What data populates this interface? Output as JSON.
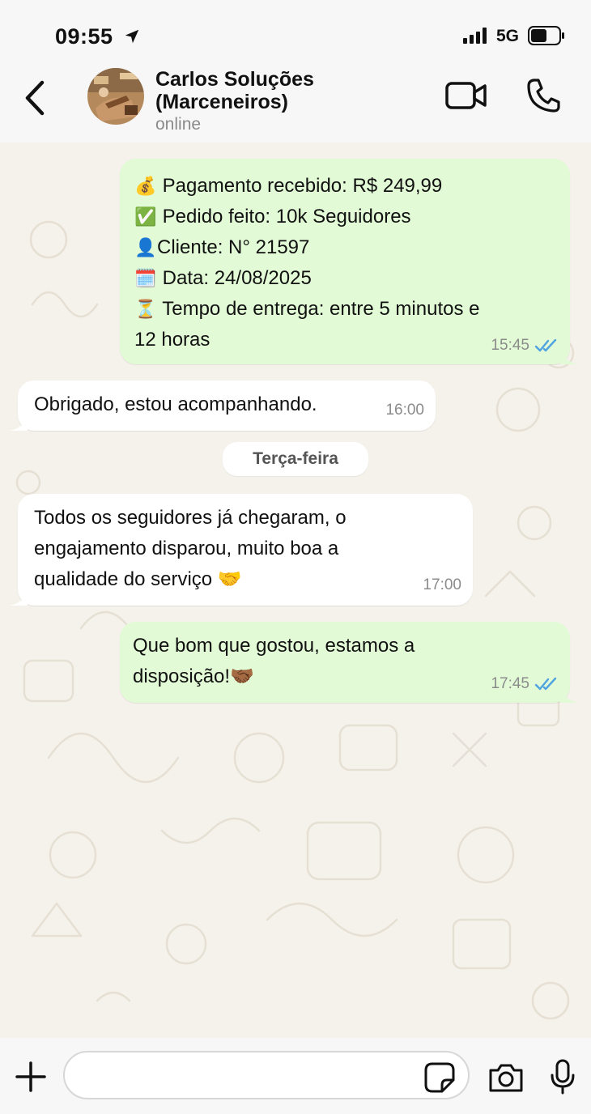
{
  "status_bar": {
    "time": "09:55",
    "network": "5G"
  },
  "header": {
    "contact_name": "Carlos Soluções (Marceneiros)",
    "contact_status": "online"
  },
  "messages": [
    {
      "direction": "outgoing",
      "lines": [
        {
          "emoji": "💰",
          "text": "Pagamento recebido: R$ 249,99"
        },
        {
          "emoji": "✅",
          "text": "Pedido feito: 10k Seguidores"
        },
        {
          "emoji": "👤",
          "text": "Cliente: N° 21597"
        },
        {
          "emoji": "🗓️",
          "text": "Data: 24/08/2025"
        },
        {
          "emoji": "⏳",
          "text": "Tempo de entrega: entre 5 minutos e"
        },
        {
          "emoji": "",
          "text": "12 horas"
        }
      ],
      "time": "15:45",
      "status": "read"
    },
    {
      "direction": "incoming",
      "lines": [
        {
          "emoji": "",
          "text": "Obrigado, estou acompanhando."
        }
      ],
      "time": "16:00"
    },
    {
      "direction": "incoming",
      "lines": [
        {
          "emoji": "",
          "text": "Todos os seguidores já chegaram, o"
        },
        {
          "emoji": "",
          "text": "engajamento disparou, muito boa a"
        },
        {
          "emoji": "",
          "text": "qualidade do serviço 🤝"
        }
      ],
      "time": "17:00"
    },
    {
      "direction": "outgoing",
      "lines": [
        {
          "emoji": "",
          "text": "Que bom que gostou, estamos a"
        },
        {
          "emoji": "",
          "text": "disposição!🤝🏾"
        }
      ],
      "time": "17:45",
      "status": "read"
    }
  ],
  "date_separator": "Terça-feira",
  "input": {
    "placeholder": ""
  },
  "colors": {
    "outgoing_bubble": "#e2fbd6",
    "incoming_bubble": "#ffffff",
    "read_ticks": "#4fa3e0",
    "background": "#f5f2ec"
  },
  "icons": [
    "location-arrow-icon",
    "signal-icon",
    "battery-icon",
    "back-chevron-icon",
    "video-camera-icon",
    "phone-icon",
    "plus-icon",
    "sticker-icon",
    "camera-icon",
    "microphone-icon",
    "double-check-icon"
  ]
}
